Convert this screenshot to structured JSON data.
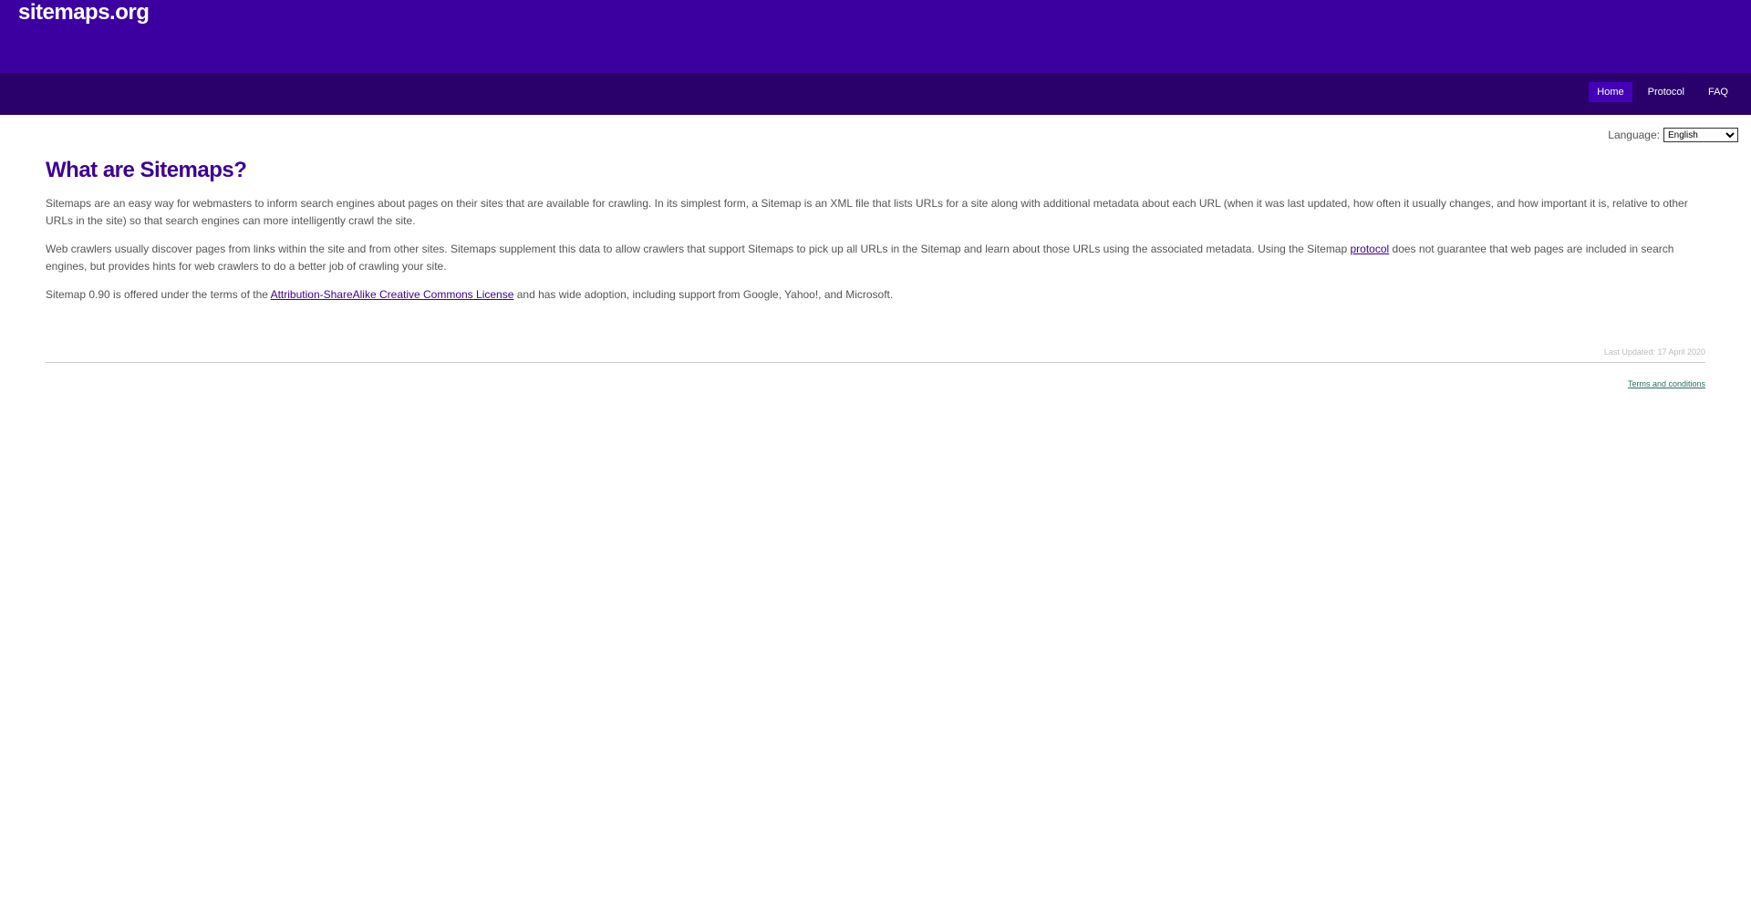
{
  "header": {
    "logo": "sitemaps.org"
  },
  "nav": {
    "items": [
      {
        "label": "Home"
      },
      {
        "label": "Protocol"
      },
      {
        "label": "FAQ"
      }
    ]
  },
  "language": {
    "label": "Language:",
    "selected": "English"
  },
  "main": {
    "title": "What are Sitemaps?",
    "p1": "Sitemaps are an easy way for webmasters to inform search engines about pages on their sites that are available for crawling. In its simplest form, a Sitemap is an XML file that lists URLs for a site along with additional metadata about each URL (when it was last updated, how often it usually changes, and how important it is, relative to other URLs in the site) so that search engines can more intelligently crawl the site.",
    "p2_before": "Web crawlers usually discover pages from links within the site and from other sites. Sitemaps supplement this data to allow crawlers that support Sitemaps to pick up all URLs in the Sitemap and learn about those URLs using the associated metadata. Using the Sitemap ",
    "p2_link": "protocol",
    "p2_after": " does not guarantee that web pages are included in search engines, but provides hints for web crawlers to do a better job of crawling your site.",
    "p3_before": "Sitemap 0.90 is offered under the terms of the ",
    "p3_link": "Attribution-ShareAlike Creative Commons License",
    "p3_after": " and has wide adoption, including support from Google, Yahoo!, and Microsoft."
  },
  "footer": {
    "last_updated": "Last Updated: 17 April 2020",
    "terms": "Terms and conditions"
  },
  "colors": {
    "header_bg": "#3d00a0",
    "navbar_bg": "#2a006b",
    "title": "#3d0094"
  }
}
